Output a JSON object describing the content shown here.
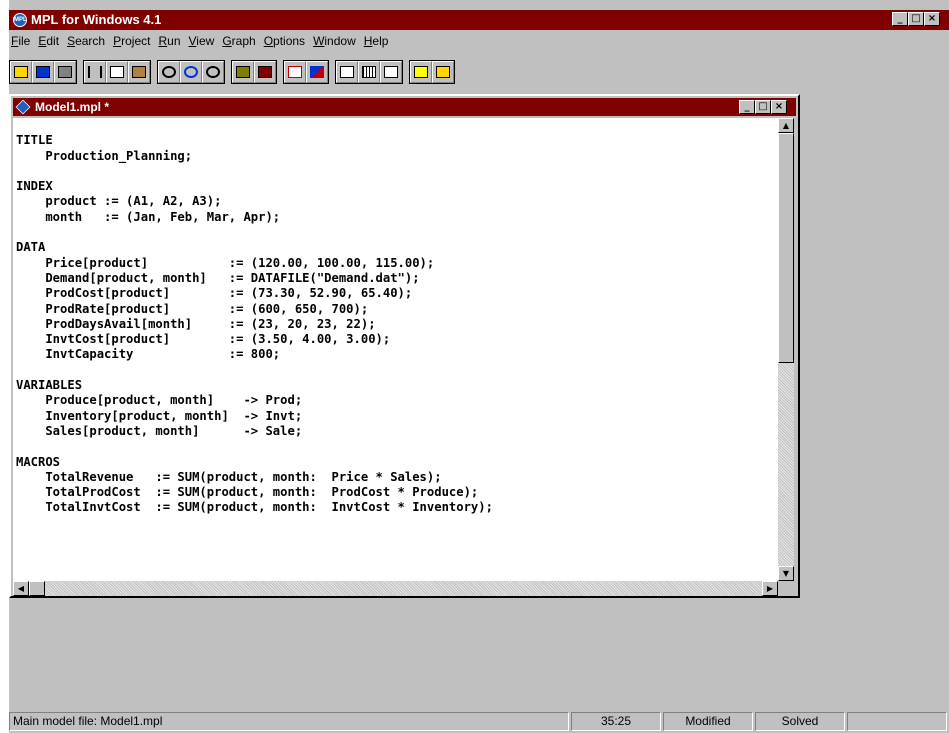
{
  "app": {
    "title": "MPL for Windows 4.1",
    "icon_text": "MPL"
  },
  "window_buttons": {
    "minimize": "_",
    "maximize": "□",
    "close": "×"
  },
  "menu": [
    {
      "label": "File",
      "ul": "F",
      "rest": "ile"
    },
    {
      "label": "Edit",
      "ul": "E",
      "rest": "dit"
    },
    {
      "label": "Search",
      "ul": "S",
      "rest": "earch"
    },
    {
      "label": "Project",
      "ul": "P",
      "rest": "roject"
    },
    {
      "label": "Run",
      "ul": "R",
      "rest": "un"
    },
    {
      "label": "View",
      "ul": "V",
      "rest": "iew"
    },
    {
      "label": "Graph",
      "ul": "G",
      "rest": "raph"
    },
    {
      "label": "Options",
      "ul": "O",
      "rest": "ptions"
    },
    {
      "label": "Window",
      "ul": "W",
      "rest": "indow"
    },
    {
      "label": "Help",
      "ul": "H",
      "rest": "elp"
    }
  ],
  "toolbar_groups": [
    [
      "open-icon",
      "save-icon",
      "print-icon"
    ],
    [
      "cut-icon",
      "copy-icon",
      "paste-icon"
    ],
    [
      "find-icon",
      "replace-icon",
      "find-next-icon"
    ],
    [
      "parse-icon",
      "solve-icon"
    ],
    [
      "check-icon",
      "graph-icon"
    ],
    [
      "sql-icon",
      "matrix-icon",
      "chart-icon"
    ],
    [
      "new-file-icon",
      "open-project-icon"
    ]
  ],
  "document": {
    "title": "Model1.mpl *",
    "lines": [
      "",
      "TITLE",
      "    Production_Planning;",
      "",
      "INDEX",
      "    product := (A1, A2, A3);",
      "    month   := (Jan, Feb, Mar, Apr);",
      "",
      "DATA",
      "    Price[product]           := (120.00, 100.00, 115.00);",
      "    Demand[product, month]   := DATAFILE(\"Demand.dat\");",
      "    ProdCost[product]        := (73.30, 52.90, 65.40);",
      "    ProdRate[product]        := (600, 650, 700);",
      "    ProdDaysAvail[month]     := (23, 20, 23, 22);",
      "    InvtCost[product]        := (3.50, 4.00, 3.00);",
      "    InvtCapacity             := 800;",
      "",
      "VARIABLES",
      "    Produce[product, month]    -> Prod;",
      "    Inventory[product, month]  -> Invt;",
      "    Sales[product, month]      -> Sale;",
      "",
      "MACROS",
      "    TotalRevenue   := SUM(product, month:  Price * Sales);",
      "    TotalProdCost  := SUM(product, month:  ProdCost * Produce);",
      "    TotalInvtCost  := SUM(product, month:  InvtCost * Inventory);"
    ]
  },
  "scroll": {
    "up": "▲",
    "down": "▼",
    "left": "◀",
    "right": "▶"
  },
  "status": {
    "main_file": "Main model file: Model1.mpl",
    "position": "35:25",
    "modified": "Modified",
    "solved": "Solved"
  }
}
